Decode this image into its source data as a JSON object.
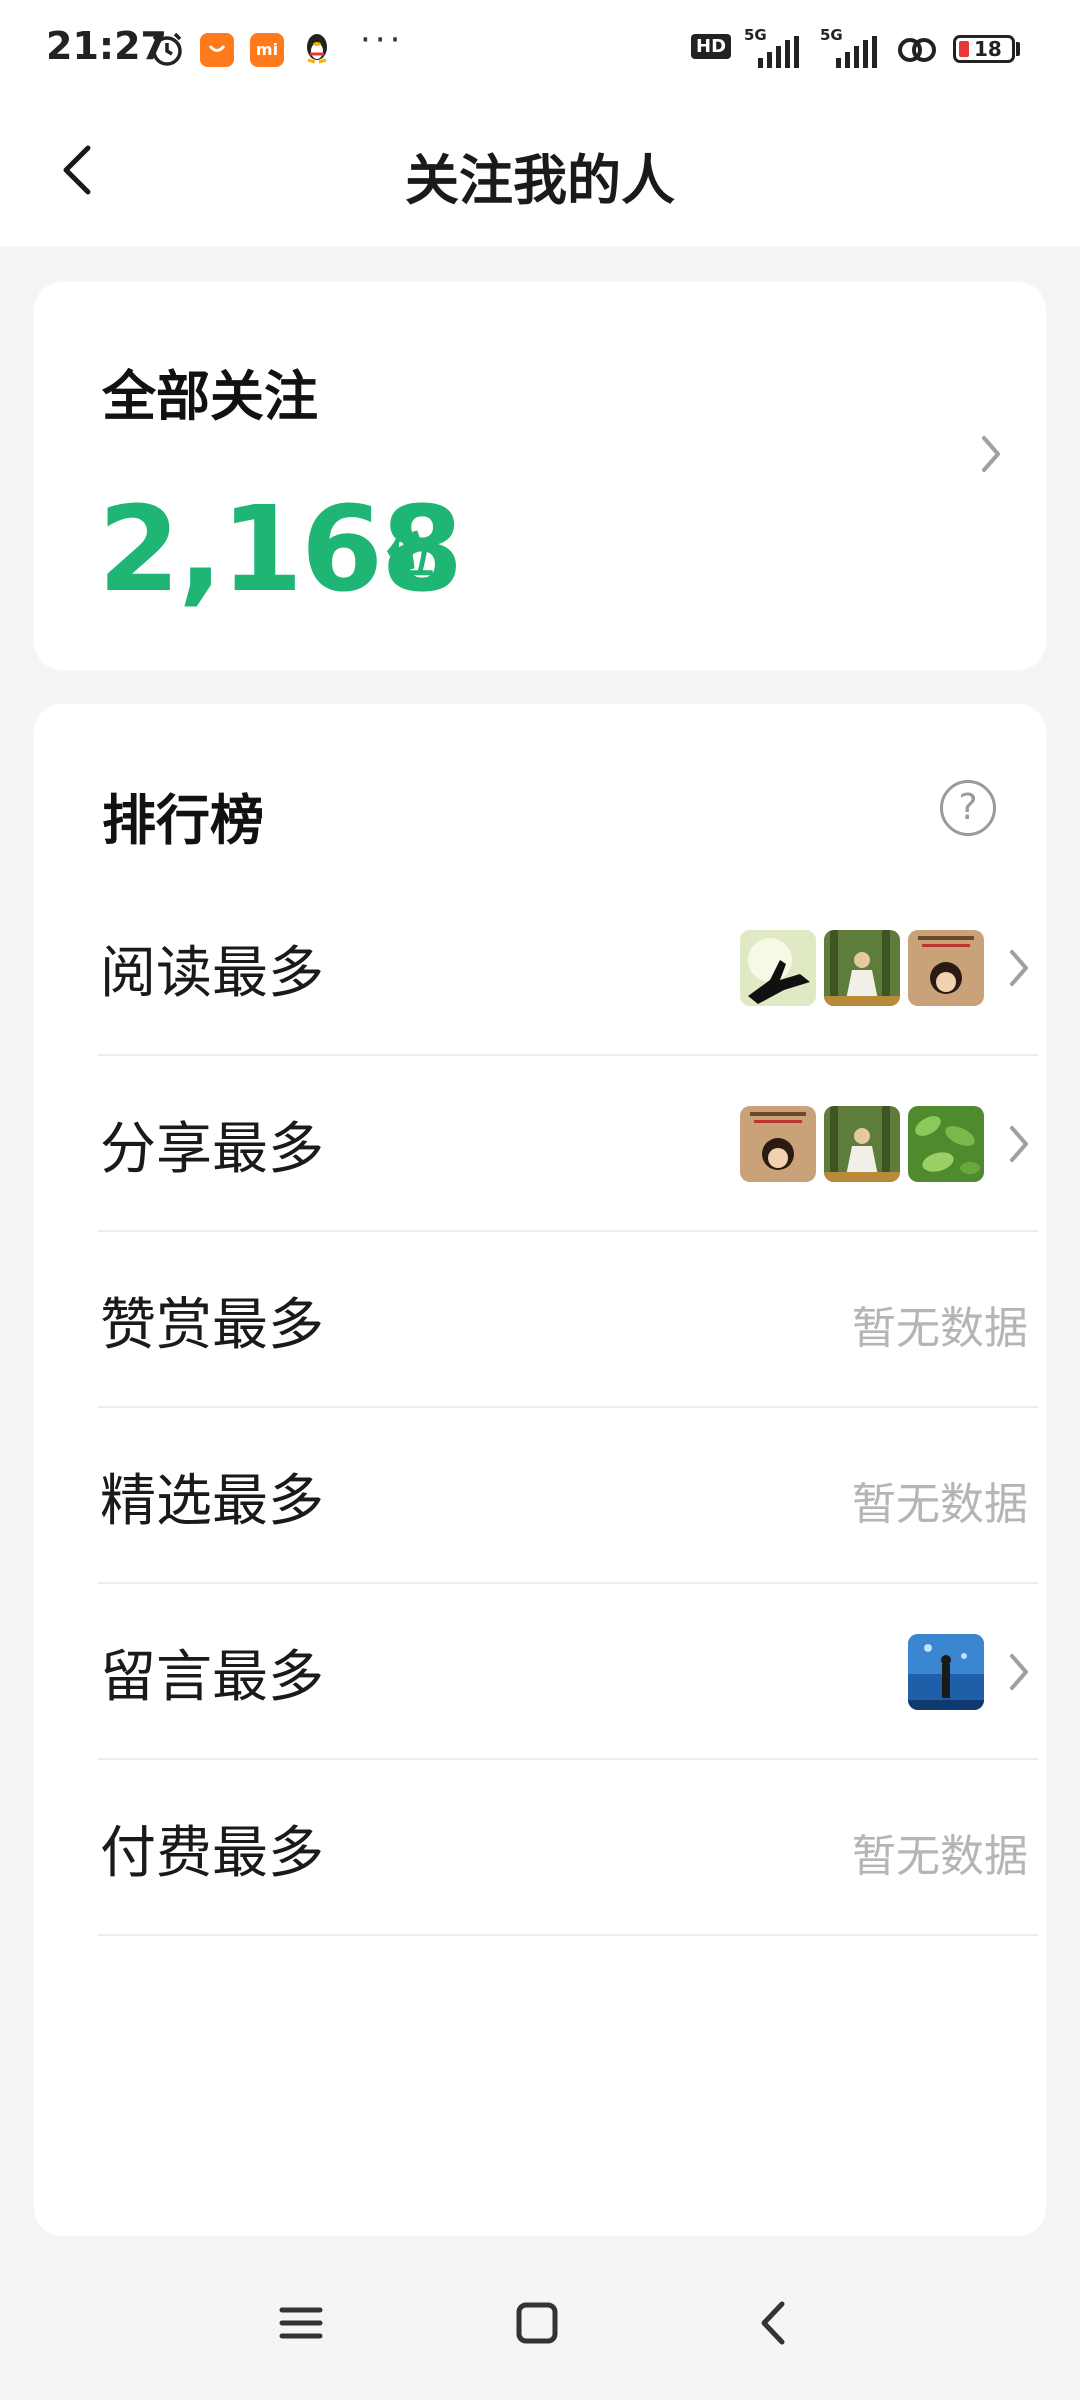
{
  "status_bar": {
    "time": "21:27",
    "app_badge": "mi",
    "more": "···",
    "network_hd": "HD",
    "network_5g_1": "5G",
    "network_5g_2": "5G",
    "battery": "18"
  },
  "header": {
    "title": "关注我的人",
    "back_icon": "back-chevron-icon"
  },
  "total_card": {
    "label": "全部关注",
    "count": "2,168",
    "unit": "位"
  },
  "ranking": {
    "title": "排行榜",
    "help_icon": "question-icon",
    "rows": [
      {
        "label": "阅读最多",
        "empty_text": "",
        "thumbs": [
          "hands-silhouette",
          "forest-girl",
          "cartoon-girl-poster"
        ]
      },
      {
        "label": "分享最多",
        "empty_text": "",
        "thumbs": [
          "cartoon-girl-poster",
          "forest-girl",
          "green-leaves"
        ]
      },
      {
        "label": "赞赏最多",
        "empty_text": "暂无数据",
        "thumbs": []
      },
      {
        "label": "精选最多",
        "empty_text": "暂无数据",
        "thumbs": []
      },
      {
        "label": "留言最多",
        "empty_text": "",
        "thumbs": [
          "underwater-person"
        ]
      },
      {
        "label": "付费最多",
        "empty_text": "暂无数据",
        "thumbs": []
      }
    ]
  },
  "colors": {
    "accent": "#1fb574",
    "muted": "#b5b5b5",
    "background": "#f5f5f5"
  }
}
